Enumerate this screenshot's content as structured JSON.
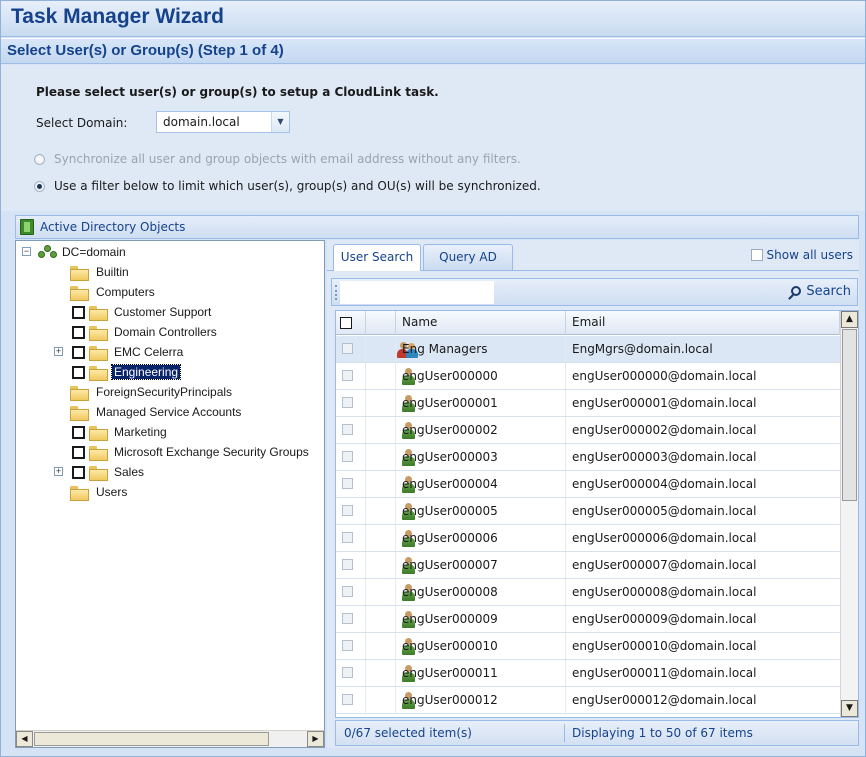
{
  "window": {
    "title": "Task Manager Wizard",
    "step": "Select User(s) or Group(s) (Step 1 of 4)"
  },
  "options": {
    "intro": "Please select user(s) or group(s) to setup a CloudLink task.",
    "domain_label": "Select Domain:",
    "domain_value": "domain.local",
    "radio_all": "Synchronize all user and group objects with email address without any filters.",
    "radio_filter": "Use a filter below to limit which user(s), group(s) and OU(s) will be synchronized.",
    "selected_radio": "filter"
  },
  "ad_panel": {
    "title": "Active Directory Objects"
  },
  "tree": {
    "root": "DC=domain",
    "nodes": [
      {
        "label": "Builtin"
      },
      {
        "label": "Computers"
      },
      {
        "label": "Customer Support"
      },
      {
        "label": "Domain Controllers"
      },
      {
        "label": "EMC Celerra"
      },
      {
        "label": "Engineering"
      },
      {
        "label": "ForeignSecurityPrincipals"
      },
      {
        "label": "Managed Service Accounts"
      },
      {
        "label": "Marketing"
      },
      {
        "label": "Microsoft Exchange Security Groups"
      },
      {
        "label": "Sales"
      },
      {
        "label": "Users"
      }
    ],
    "selected": "Engineering"
  },
  "tabs": [
    {
      "label": "User Search",
      "active": true
    },
    {
      "label": "Query AD",
      "active": false
    }
  ],
  "show_all_users": "Show all users",
  "search": {
    "value": "",
    "button": "Search"
  },
  "grid": {
    "columns": [
      "Name",
      "Email"
    ],
    "rows": [
      {
        "name": "Eng Managers",
        "email": "EngMgrs@domain.local",
        "type": "group"
      },
      {
        "name": "engUser000000",
        "email": "engUser000000@domain.local",
        "type": "user"
      },
      {
        "name": "engUser000001",
        "email": "engUser000001@domain.local",
        "type": "user"
      },
      {
        "name": "engUser000002",
        "email": "engUser000002@domain.local",
        "type": "user"
      },
      {
        "name": "engUser000003",
        "email": "engUser000003@domain.local",
        "type": "user"
      },
      {
        "name": "engUser000004",
        "email": "engUser000004@domain.local",
        "type": "user"
      },
      {
        "name": "engUser000005",
        "email": "engUser000005@domain.local",
        "type": "user"
      },
      {
        "name": "engUser000006",
        "email": "engUser000006@domain.local",
        "type": "user"
      },
      {
        "name": "engUser000007",
        "email": "engUser000007@domain.local",
        "type": "user"
      },
      {
        "name": "engUser000008",
        "email": "engUser000008@domain.local",
        "type": "user"
      },
      {
        "name": "engUser000009",
        "email": "engUser000009@domain.local",
        "type": "user"
      },
      {
        "name": "engUser000010",
        "email": "engUser000010@domain.local",
        "type": "user"
      },
      {
        "name": "engUser000011",
        "email": "engUser000011@domain.local",
        "type": "user"
      },
      {
        "name": "engUser000012",
        "email": "engUser000012@domain.local",
        "type": "user"
      }
    ]
  },
  "status": {
    "selected": "0/67 selected item(s)",
    "paging": "Displaying 1 to 50 of 67 items"
  },
  "colors": {
    "title_text": "#15428b",
    "panel_bg": "#dfe9f6",
    "border": "#99bbe8",
    "tree_selection": "#0a246a"
  }
}
